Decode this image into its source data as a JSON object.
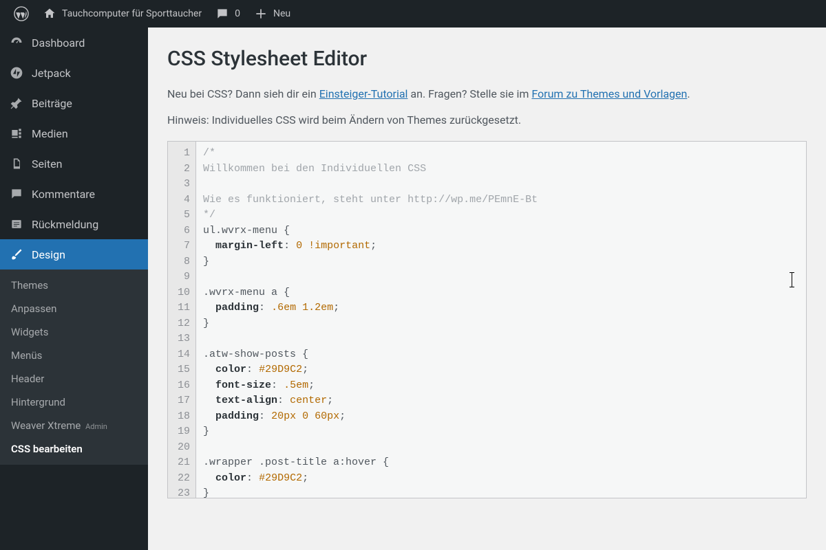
{
  "topbar": {
    "site_title": "Tauchcomputer für Sporttaucher",
    "comments_count": "0",
    "new_label": "Neu"
  },
  "sidebar": {
    "items": [
      {
        "label": "Dashboard",
        "icon": "dashboard"
      },
      {
        "label": "Jetpack",
        "icon": "jetpack"
      },
      {
        "label": "Beiträge",
        "icon": "pin"
      },
      {
        "label": "Medien",
        "icon": "media"
      },
      {
        "label": "Seiten",
        "icon": "pages"
      },
      {
        "label": "Kommentare",
        "icon": "comments"
      },
      {
        "label": "Rückmeldung",
        "icon": "feedback"
      },
      {
        "label": "Design",
        "icon": "brush",
        "active": true
      }
    ],
    "submenu": [
      {
        "label": "Themes"
      },
      {
        "label": "Anpassen"
      },
      {
        "label": "Widgets"
      },
      {
        "label": "Menüs"
      },
      {
        "label": "Header"
      },
      {
        "label": "Hintergrund"
      },
      {
        "label": "Weaver Xtreme",
        "suffix": "Admin"
      },
      {
        "label": "CSS bearbeiten",
        "current": true
      }
    ]
  },
  "page": {
    "title": "CSS Stylesheet Editor",
    "intro_before": "Neu bei CSS? Dann sieh dir ein ",
    "intro_link1": "Einsteiger-Tutorial",
    "intro_mid": " an. Fragen? Stelle sie im ",
    "intro_link2": "Forum zu Themes und Vorlagen",
    "intro_after": ".",
    "hint": "Hinweis: Individuelles CSS wird beim Ändern von Themes zurückgesetzt."
  },
  "editor": {
    "lines": [
      "/*",
      "Willkommen bei den Individuellen CSS",
      "",
      "Wie es funktioniert, steht unter http://wp.me/PEmnE-Bt",
      "*/",
      "ul.wvrx-menu {",
      "  margin-left: 0 !important;",
      "}",
      "",
      ".wvrx-menu a {",
      "  padding: .6em 1.2em;",
      "}",
      "",
      ".atw-show-posts {",
      "  color: #29D9C2;",
      "  font-size: .5em;",
      "  text-align: center;",
      "  padding: 20px 0 60px;",
      "}",
      "",
      ".wrapper .post-title a:hover {",
      "  color: #29D9C2;",
      "}"
    ]
  }
}
